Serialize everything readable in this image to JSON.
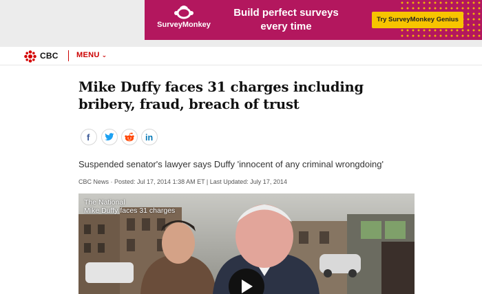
{
  "ad": {
    "brand": "SurveyMonkey",
    "headline_line1": "Build perfect surveys",
    "headline_line2": "every time",
    "cta": "Try SurveyMonkey Genius",
    "colors": {
      "background": "#b3175e",
      "cta": "#f7c400"
    }
  },
  "nav": {
    "logo_text": "CBC",
    "menu_label": "MENU"
  },
  "article": {
    "headline": "Mike Duffy faces 31 charges including bribery, fraud, breach of trust",
    "deck": "Suspended senator's lawyer says Duffy 'innocent of any criminal wrongdoing'",
    "byline": "CBC News · Posted: Jul 17, 2014 1:38 AM ET | Last Updated: July 17, 2014"
  },
  "share": [
    {
      "icon": "facebook-icon",
      "color": "#3b5998"
    },
    {
      "icon": "twitter-icon",
      "color": "#1da1f2"
    },
    {
      "icon": "reddit-icon",
      "color": "#ff4500"
    },
    {
      "icon": "linkedin-icon",
      "color": "#0077b5"
    }
  ],
  "video": {
    "show": "The National",
    "title": "Mike Duffy faces 31 charges"
  }
}
